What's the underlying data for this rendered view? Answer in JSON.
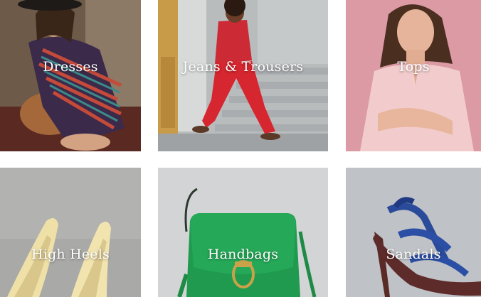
{
  "categories": [
    {
      "label": "Dresses",
      "image": "woman-in-striped-dress-photo"
    },
    {
      "label": "Jeans & Trousers",
      "image": "woman-in-red-suit-photo"
    },
    {
      "label": "Tops",
      "image": "woman-in-pink-top-photo"
    },
    {
      "label": "High Heels",
      "image": "yellow-high-heels-photo"
    },
    {
      "label": "Handbags",
      "image": "green-handbag-photo"
    },
    {
      "label": "Sandals",
      "image": "blue-strappy-sandal-photo"
    }
  ]
}
